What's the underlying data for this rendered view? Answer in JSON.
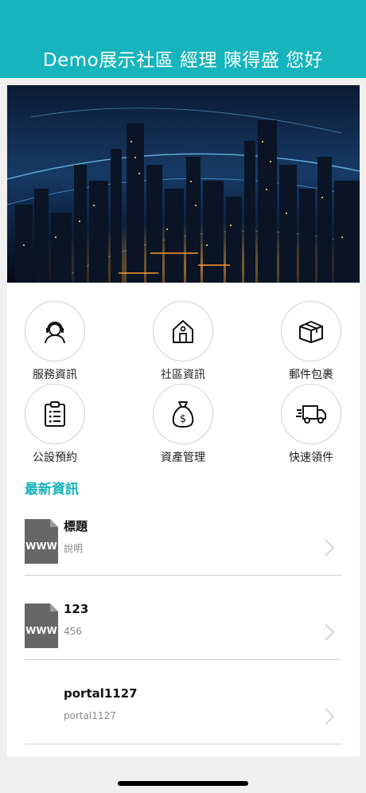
{
  "header": {
    "title": "Demo展示社區 經理 陳得盛 您好",
    "bg_color": "#16b4bd"
  },
  "menu": [
    {
      "label": "服務資訊",
      "icon": "headset-person-icon"
    },
    {
      "label": "社區資訊",
      "icon": "house-icon"
    },
    {
      "label": "郵件包裹",
      "icon": "package-box-icon"
    },
    {
      "label": "公設預約",
      "icon": "clipboard-list-icon"
    },
    {
      "label": "資產管理",
      "icon": "money-bag-icon"
    },
    {
      "label": "快速領件",
      "icon": "delivery-truck-icon"
    }
  ],
  "news": {
    "section_title": "最新資訊",
    "accent_color": "#18b3bb",
    "items": [
      {
        "title": "標題",
        "desc": "說明",
        "thumb": "WWW",
        "thumb_icon": "www-file-icon"
      },
      {
        "title": "123",
        "desc": "456",
        "thumb": "WWW",
        "thumb_icon": "www-file-icon"
      },
      {
        "title": "portal1127",
        "desc": "portal1127",
        "thumb": "",
        "thumb_icon": "blank-thumbnail"
      }
    ]
  }
}
